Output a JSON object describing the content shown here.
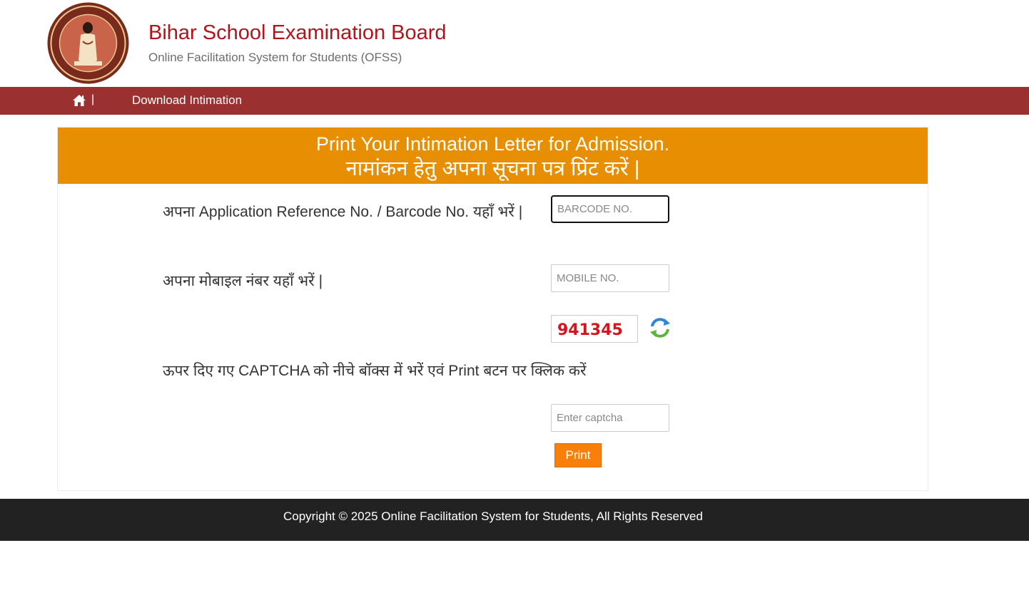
{
  "header": {
    "title": "Bihar School Examination Board",
    "subtitle": "Online Facilitation System for Students (OFSS)",
    "logo_icon": "bseb-emblem-logo"
  },
  "nav": {
    "home_icon": "home-icon",
    "separator": "|",
    "link_label": "Download Intimation"
  },
  "panel": {
    "heading_en": "Print Your Intimation Letter for Admission.",
    "heading_hi": "नामांकन हेतु अपना सूचना पत्र प्रिंट करें |"
  },
  "form": {
    "barcode_label": "अपना Application Reference No. / Barcode No. यहाँ भरें |",
    "barcode_placeholder": "BARCODE NO.",
    "barcode_value": "",
    "mobile_label": "अपना मोबाइल नंबर यहाँ भरें |",
    "mobile_placeholder": "MOBILE NO.",
    "mobile_value": "",
    "captcha_code": "941345",
    "refresh_icon": "refresh-icon",
    "captcha_instruction": "ऊपर दिए गए CAPTCHA को नीचे बॉक्स में भरें एवं Print बटन पर क्लिक करें",
    "captcha_placeholder": "Enter captcha",
    "captcha_value": "",
    "print_label": "Print"
  },
  "footer": {
    "copyright": "Copyright © 2025 Online Facilitation System for Students, All Rights Reserved"
  },
  "colors": {
    "brand_red": "#b3141b",
    "nav_bg": "#9b3031",
    "heading_bg": "#e88e02",
    "button_bg": "#f8800a",
    "footer_bg": "#222222"
  }
}
